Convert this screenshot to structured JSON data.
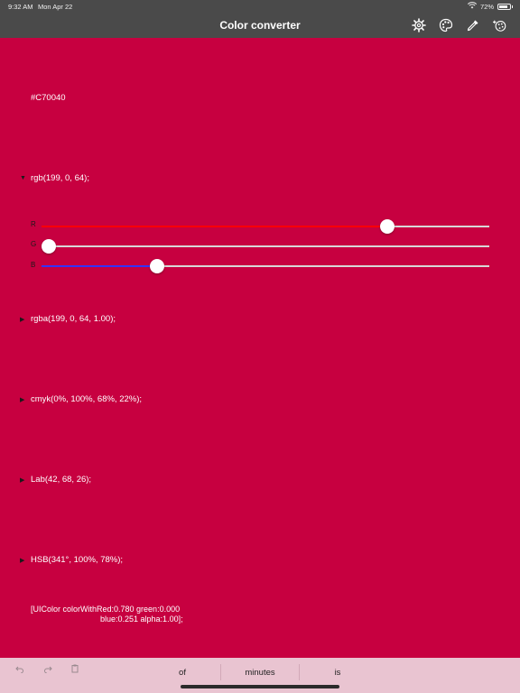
{
  "status": {
    "time": "9:32 AM",
    "date": "Mon Apr 22",
    "battery": "72%"
  },
  "nav": {
    "title": "Color converter",
    "icons": [
      "gear-icon",
      "palette-icon",
      "eyedropper-icon",
      "color-wheel-icon"
    ]
  },
  "color": {
    "hex": "#C70040",
    "background": "#C70040"
  },
  "sections": {
    "rgb": "rgb(199, 0, 64);",
    "rgba": "rgba(199, 0, 64, 1.00);",
    "cmyk": "cmyk(0%, 100%, 68%, 22%);",
    "lab": "Lab(42, 68, 26);",
    "hsb": "HSB(341°, 100%, 78%);"
  },
  "sliders": [
    {
      "label": "R",
      "value": 199,
      "max": 255,
      "color": "#ff0000"
    },
    {
      "label": "G",
      "value": 0,
      "max": 255,
      "color": "#00cc00"
    },
    {
      "label": "B",
      "value": 64,
      "max": 255,
      "color": "#3333ff"
    }
  ],
  "uicolor": {
    "line1": "[UIColor colorWithRed:0.780 green:0.000",
    "line2": "blue:0.251 alpha:1.00];"
  },
  "keyboard_bar": {
    "suggestions": [
      "of",
      "minutes",
      "is"
    ],
    "icons": [
      "undo-icon",
      "redo-icon",
      "paste-icon"
    ]
  }
}
